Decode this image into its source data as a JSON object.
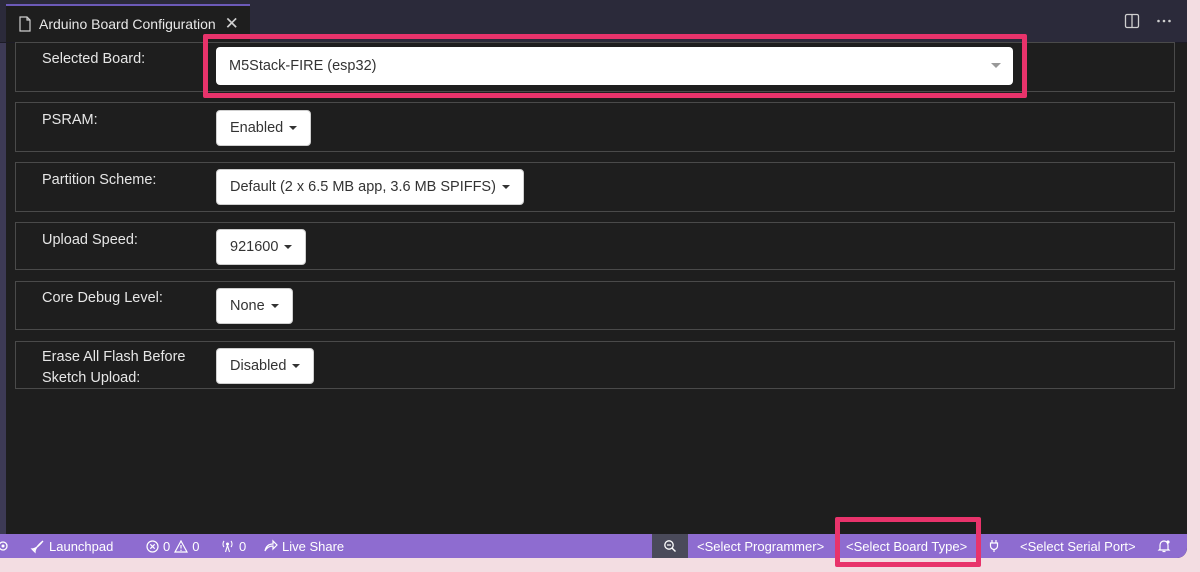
{
  "tab": {
    "title": "Arduino Board Configuration",
    "close_glyph": "✕",
    "icons": [
      "file-icon",
      "split-editor-icon",
      "more-actions-icon"
    ]
  },
  "config": {
    "selected_board": {
      "label": "Selected Board:",
      "value": "M5Stack-FIRE (esp32)"
    },
    "rows": [
      {
        "label": "PSRAM:",
        "value": "Enabled"
      },
      {
        "label": "Partition Scheme:",
        "value": "Default (2 x 6.5 MB app, 3.6 MB SPIFFS)"
      },
      {
        "label": "Upload Speed:",
        "value": "921600"
      },
      {
        "label": "Core Debug Level:",
        "value": "None"
      },
      {
        "label_line1": "Erase All Flash Before",
        "label_line2": "Sketch Upload:",
        "value": "Disabled"
      }
    ]
  },
  "statusbar": {
    "launchpad": "Launchpad",
    "errors": "0",
    "warnings": "0",
    "ports": "0",
    "live_share": "Live Share",
    "select_programmer": "<Select Programmer>",
    "select_board_type": "<Select Board Type>",
    "select_serial_port": "<Select Serial Port>"
  },
  "colors": {
    "highlight": "#e8336b",
    "statusbar": "#8e6cd0",
    "editor_bg": "#1e1e1e"
  }
}
